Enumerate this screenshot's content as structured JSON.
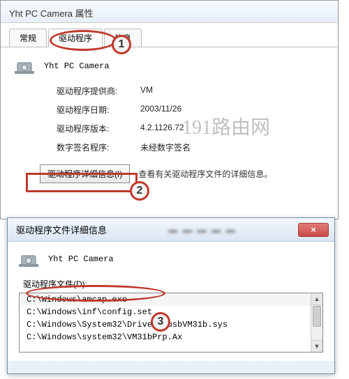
{
  "main": {
    "title": "Yht PC Camera 属性",
    "tabs": [
      {
        "label": "常规"
      },
      {
        "label": "驱动程序"
      },
      {
        "label": "   信息"
      }
    ],
    "device_name": "Yht PC Camera",
    "rows": [
      {
        "label": "驱动程序提供商:",
        "value": "VM"
      },
      {
        "label": "驱动程序日期:",
        "value": "2003/11/26"
      },
      {
        "label": "驱动程序版本:",
        "value": "4.2.1126.72"
      },
      {
        "label": "数字签名程序:",
        "value": "未经数字签名"
      }
    ],
    "detail_button": "驱动程序详细信息(I)",
    "detail_desc": "查看有关驱动程序文件的详细信息。"
  },
  "details": {
    "title": "驱动程序文件详细信息",
    "device_name": "Yht PC Camera",
    "files_label": "驱动程序文件(D):",
    "files": [
      "C:\\Windows\\amcap.exe",
      "C:\\Windows\\inf\\config.set",
      "C:\\Windows\\System32\\Drivers\\usbVM31b.sys",
      "C:\\Windows\\system32\\VM31bPrp.Ax"
    ],
    "close_label": "×"
  },
  "watermark": "191路由网",
  "markers": {
    "m1": "1",
    "m2": "2",
    "m3": "3"
  }
}
